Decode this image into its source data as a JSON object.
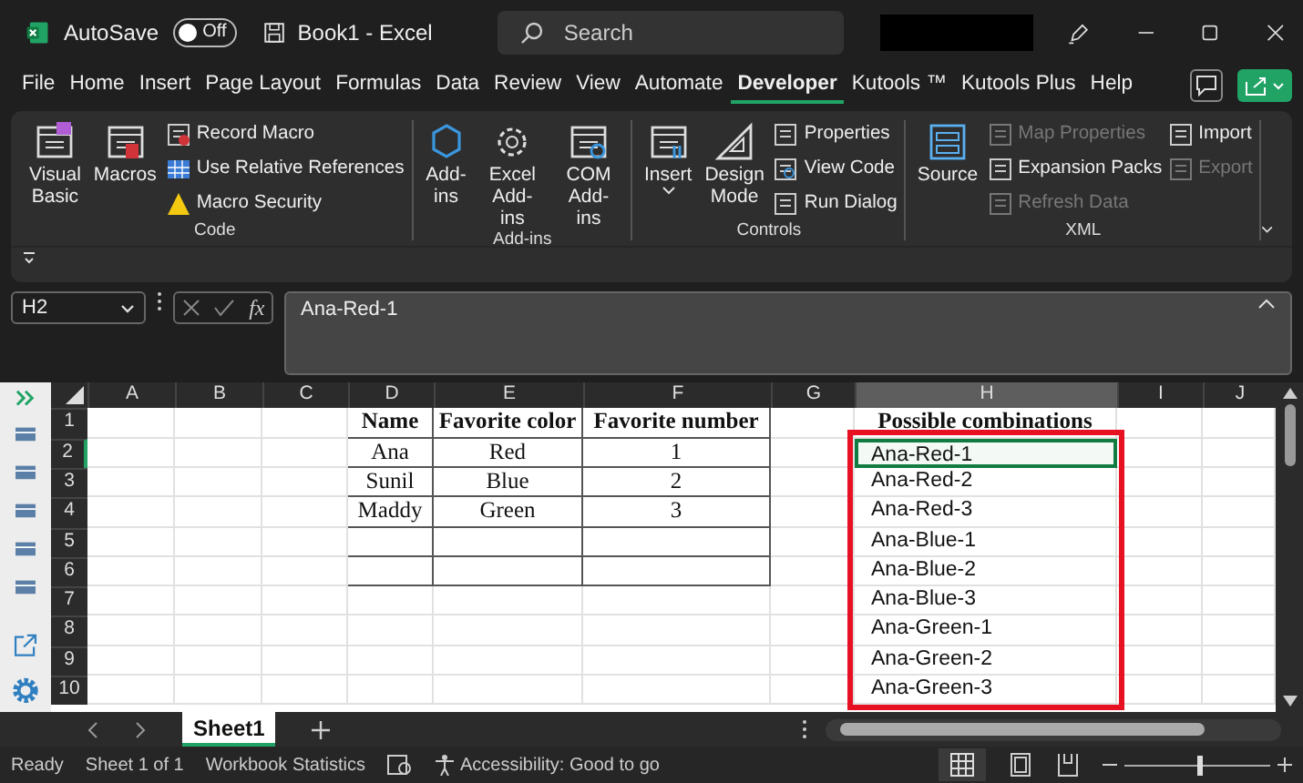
{
  "title_bar": {
    "autosave_label": "AutoSave",
    "autosave_on": false,
    "autosave_state": "Off",
    "document_title": "Book1  -  Excel",
    "search_placeholder": "Search"
  },
  "menu_tabs": [
    {
      "label": "File",
      "selected": false
    },
    {
      "label": "Home",
      "selected": false
    },
    {
      "label": "Insert",
      "selected": false
    },
    {
      "label": "Page Layout",
      "selected": false
    },
    {
      "label": "Formulas",
      "selected": false
    },
    {
      "label": "Data",
      "selected": false
    },
    {
      "label": "Review",
      "selected": false
    },
    {
      "label": "View",
      "selected": false
    },
    {
      "label": "Automate",
      "selected": false
    },
    {
      "label": "Developer",
      "selected": true
    },
    {
      "label": "Kutools ™",
      "selected": false
    },
    {
      "label": "Kutools Plus",
      "selected": false
    },
    {
      "label": "Help",
      "selected": false
    }
  ],
  "ribbon_groups": [
    {
      "name": "Code",
      "items": [
        {
          "label": "Visual Basic",
          "kind": "large",
          "disabled": false
        },
        {
          "label": "Macros",
          "kind": "large",
          "disabled": false
        },
        {
          "label": "Record Macro",
          "kind": "small",
          "disabled": false
        },
        {
          "label": "Use Relative References",
          "kind": "small",
          "disabled": false
        },
        {
          "label": "Macro Security",
          "kind": "small",
          "disabled": false
        }
      ]
    },
    {
      "name": "Add-ins",
      "items": [
        {
          "label": "Add-ins",
          "kind": "large",
          "disabled": false
        },
        {
          "label": "Excel Add-ins",
          "kind": "large",
          "disabled": false
        },
        {
          "label": "COM Add-ins",
          "kind": "large",
          "disabled": false
        }
      ]
    },
    {
      "name": "Controls",
      "items": [
        {
          "label": "Insert",
          "kind": "large",
          "disabled": false
        },
        {
          "label": "Design Mode",
          "kind": "large",
          "disabled": false
        },
        {
          "label": "Properties",
          "kind": "small",
          "disabled": false
        },
        {
          "label": "View Code",
          "kind": "small",
          "disabled": false
        },
        {
          "label": "Run Dialog",
          "kind": "small",
          "disabled": false
        }
      ]
    },
    {
      "name": "XML",
      "items": [
        {
          "label": "Source",
          "kind": "large",
          "disabled": false
        },
        {
          "label": "Map Properties",
          "kind": "small",
          "disabled": true
        },
        {
          "label": "Expansion Packs",
          "kind": "small",
          "disabled": false
        },
        {
          "label": "Refresh Data",
          "kind": "small",
          "disabled": true
        },
        {
          "label": "Import",
          "kind": "small",
          "disabled": false
        },
        {
          "label": "Export",
          "kind": "small",
          "disabled": true
        }
      ]
    }
  ],
  "formula_bar": {
    "name_box": "H2",
    "function_label": "fx",
    "value": "Ana-Red-1"
  },
  "columns": [
    {
      "label": "A",
      "selected": false
    },
    {
      "label": "B",
      "selected": false
    },
    {
      "label": "C",
      "selected": false
    },
    {
      "label": "D",
      "selected": false
    },
    {
      "label": "E",
      "selected": false
    },
    {
      "label": "F",
      "selected": false
    },
    {
      "label": "G",
      "selected": false
    },
    {
      "label": "H",
      "selected": true
    },
    {
      "label": "I",
      "selected": false
    },
    {
      "label": "J",
      "selected": false
    }
  ],
  "row_headers": [
    {
      "label": "1",
      "selected": false
    },
    {
      "label": "2",
      "selected": true
    },
    {
      "label": "3",
      "selected": false
    },
    {
      "label": "4",
      "selected": false
    },
    {
      "label": "5",
      "selected": false
    },
    {
      "label": "6",
      "selected": false
    },
    {
      "label": "7",
      "selected": false
    },
    {
      "label": "8",
      "selected": false
    },
    {
      "label": "9",
      "selected": false
    },
    {
      "label": "10",
      "selected": false
    }
  ],
  "table": {
    "columns": [
      "Name",
      "Favorite color",
      "Favorite number"
    ],
    "rows": [
      [
        "Ana",
        "Red",
        "1"
      ],
      [
        "Sunil",
        "Blue",
        "2"
      ],
      [
        "Maddy",
        "Green",
        "3"
      ]
    ]
  },
  "combinations": {
    "header": "Possible combinations",
    "items": [
      {
        "text": "Ana-Red-1",
        "selected": true
      },
      {
        "text": "Ana-Red-2",
        "selected": false
      },
      {
        "text": "Ana-Red-3",
        "selected": false
      },
      {
        "text": "Ana-Blue-1",
        "selected": false
      },
      {
        "text": "Ana-Blue-2",
        "selected": false
      },
      {
        "text": "Ana-Blue-3",
        "selected": false
      },
      {
        "text": "Ana-Green-1",
        "selected": false
      },
      {
        "text": "Ana-Green-2",
        "selected": false
      },
      {
        "text": "Ana-Green-3",
        "selected": false
      }
    ]
  },
  "sheet_tabs": [
    {
      "label": "Sheet1",
      "selected": true
    }
  ],
  "status_bar": {
    "items": [
      "Ready",
      "Sheet 1 of 1",
      "Workbook Statistics"
    ],
    "accessibility": "Accessibility: Good to go",
    "zoom": {
      "level": 0.5
    }
  }
}
